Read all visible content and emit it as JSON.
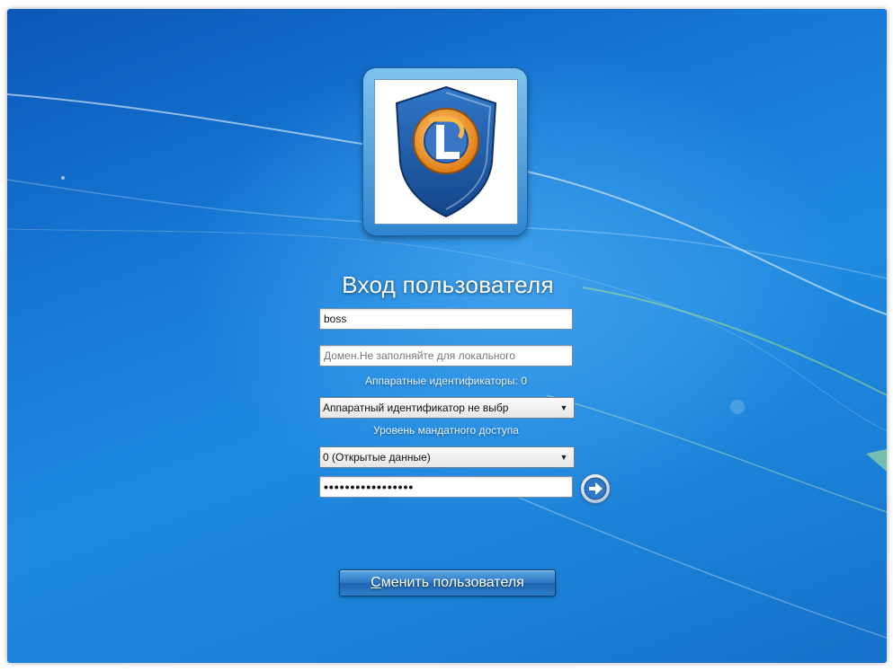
{
  "login": {
    "title": "Вход пользователя",
    "username_value": "boss",
    "domain_placeholder": "Домен.Не заполняйте для локального",
    "hw_ids_label": "Аппаратные идентификаторы: 0",
    "hw_id_select": "Аппаратный идентификатор не выбр",
    "access_level_label": "Уровень мандатного доступа",
    "access_level_select": "0 (Открытые данные)",
    "password_mask": "•••••••••••••••••",
    "switch_user_accel": "С",
    "switch_user_rest": "менить пользователя"
  },
  "icons": {
    "logo": "dl-shield-logo",
    "submit": "arrow-right-icon",
    "dropdown": "chevron-down-icon"
  },
  "colors": {
    "background": "#1677d4",
    "button": "#2c79c4"
  }
}
